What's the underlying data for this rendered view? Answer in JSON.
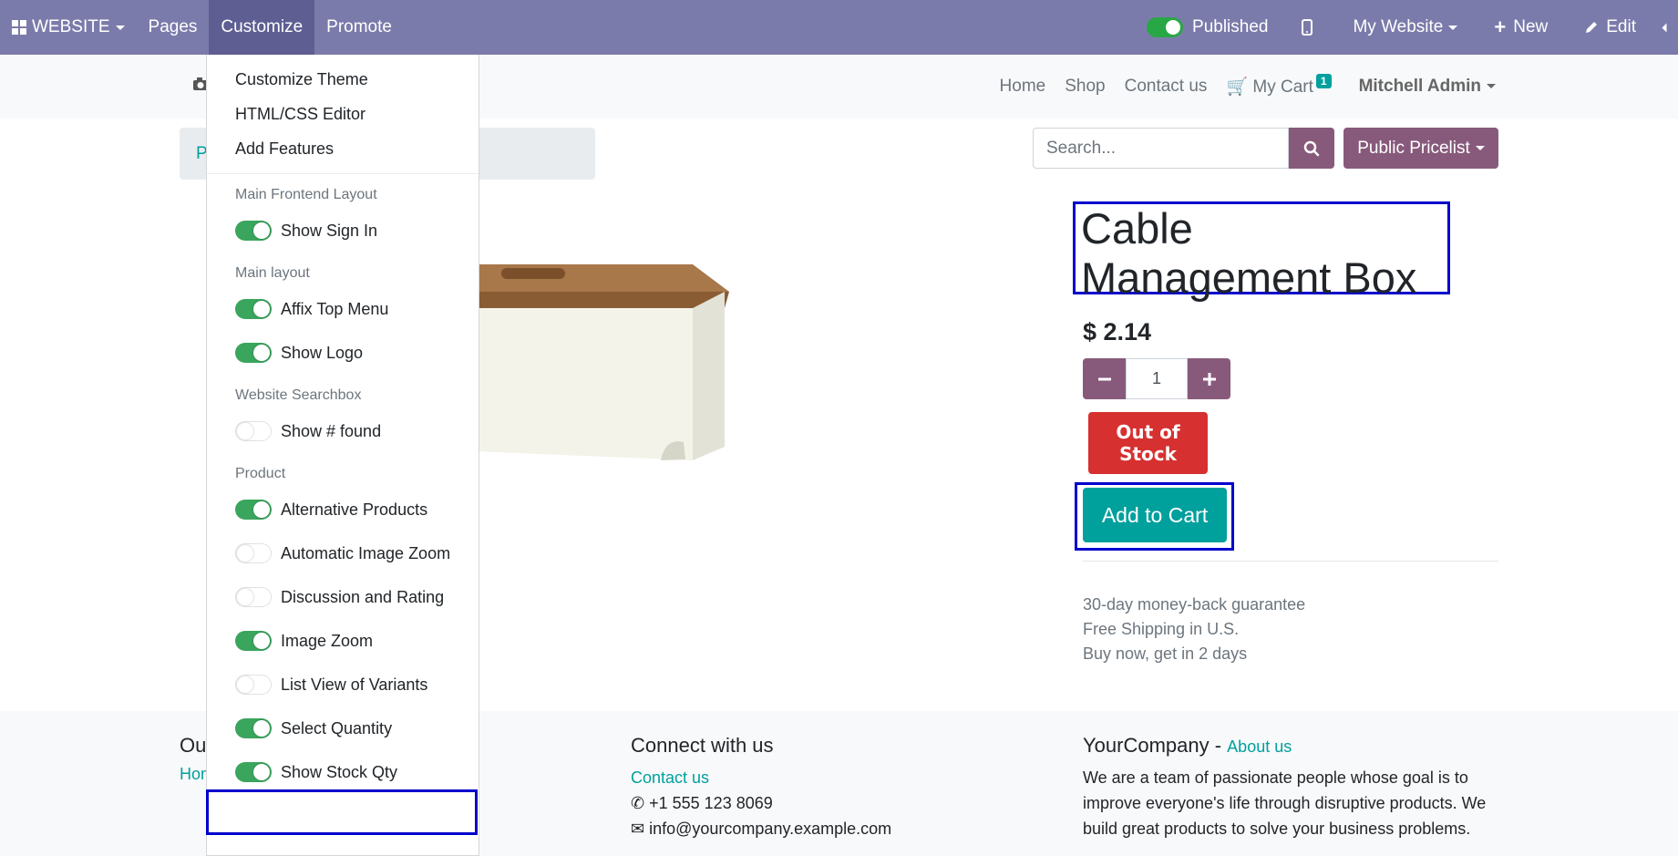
{
  "topbar": {
    "brand": "WEBSITE",
    "pages": "Pages",
    "customize": "Customize",
    "promote": "Promote",
    "published": "Published",
    "site": "My Website",
    "new": "New",
    "edit": "Edit"
  },
  "header": {
    "nav": {
      "home": "Home",
      "shop": "Shop",
      "contact": "Contact us",
      "cart": "My Cart",
      "cart_count": "1"
    },
    "user": "Mitchell Admin"
  },
  "breadcrumb": {
    "visible_text": "P"
  },
  "search": {
    "placeholder": "Search..."
  },
  "pricelist": "Public Pricelist",
  "product": {
    "title": "Cable Management Box",
    "price": "$ 2.14",
    "quantity": "1",
    "stock_badge": "Out of Stock",
    "add_to_cart": "Add to Cart",
    "guarantees": [
      "30-day money-back guarantee",
      "Free Shipping in U.S.",
      "Buy now, get in 2 days"
    ]
  },
  "footer": {
    "col_a": {
      "title_partial": "Ou",
      "link_partial": "Hom"
    },
    "col_b": {
      "title": "Connect with us",
      "contact": "Contact us",
      "phone": "+1 555 123 8069",
      "email": "info@yourcompany.example.com"
    },
    "col_c": {
      "company": "YourCompany",
      "separator": " - ",
      "about_link": "About us",
      "about": "We are a team of passionate people whose goal is to improve everyone's life through disruptive products. We build great products to solve your business problems."
    }
  },
  "customize_menu": {
    "items": [
      "Customize Theme",
      "HTML/CSS Editor",
      "Add Features"
    ],
    "sections": [
      {
        "header": "Main Frontend Layout",
        "toggles": [
          {
            "label": "Show Sign In",
            "on": true
          }
        ]
      },
      {
        "header": "Main layout",
        "toggles": [
          {
            "label": "Affix Top Menu",
            "on": true
          },
          {
            "label": "Show Logo",
            "on": true
          }
        ]
      },
      {
        "header": "Website Searchbox",
        "toggles": [
          {
            "label": "Show # found",
            "on": false
          }
        ]
      },
      {
        "header": "Product",
        "toggles": [
          {
            "label": "Alternative Products",
            "on": true
          },
          {
            "label": "Automatic Image Zoom",
            "on": false
          },
          {
            "label": "Discussion and Rating",
            "on": false
          },
          {
            "label": "Image Zoom",
            "on": true
          },
          {
            "label": "List View of Variants",
            "on": false
          },
          {
            "label": "Select Quantity",
            "on": true
          },
          {
            "label": "Show Stock Qty",
            "on": true
          }
        ]
      }
    ]
  },
  "colors": {
    "topbar": "#7b7bab",
    "primary": "#875a7b",
    "teal": "#00a09d",
    "danger": "#d63030",
    "highlight": "#0000cc"
  }
}
